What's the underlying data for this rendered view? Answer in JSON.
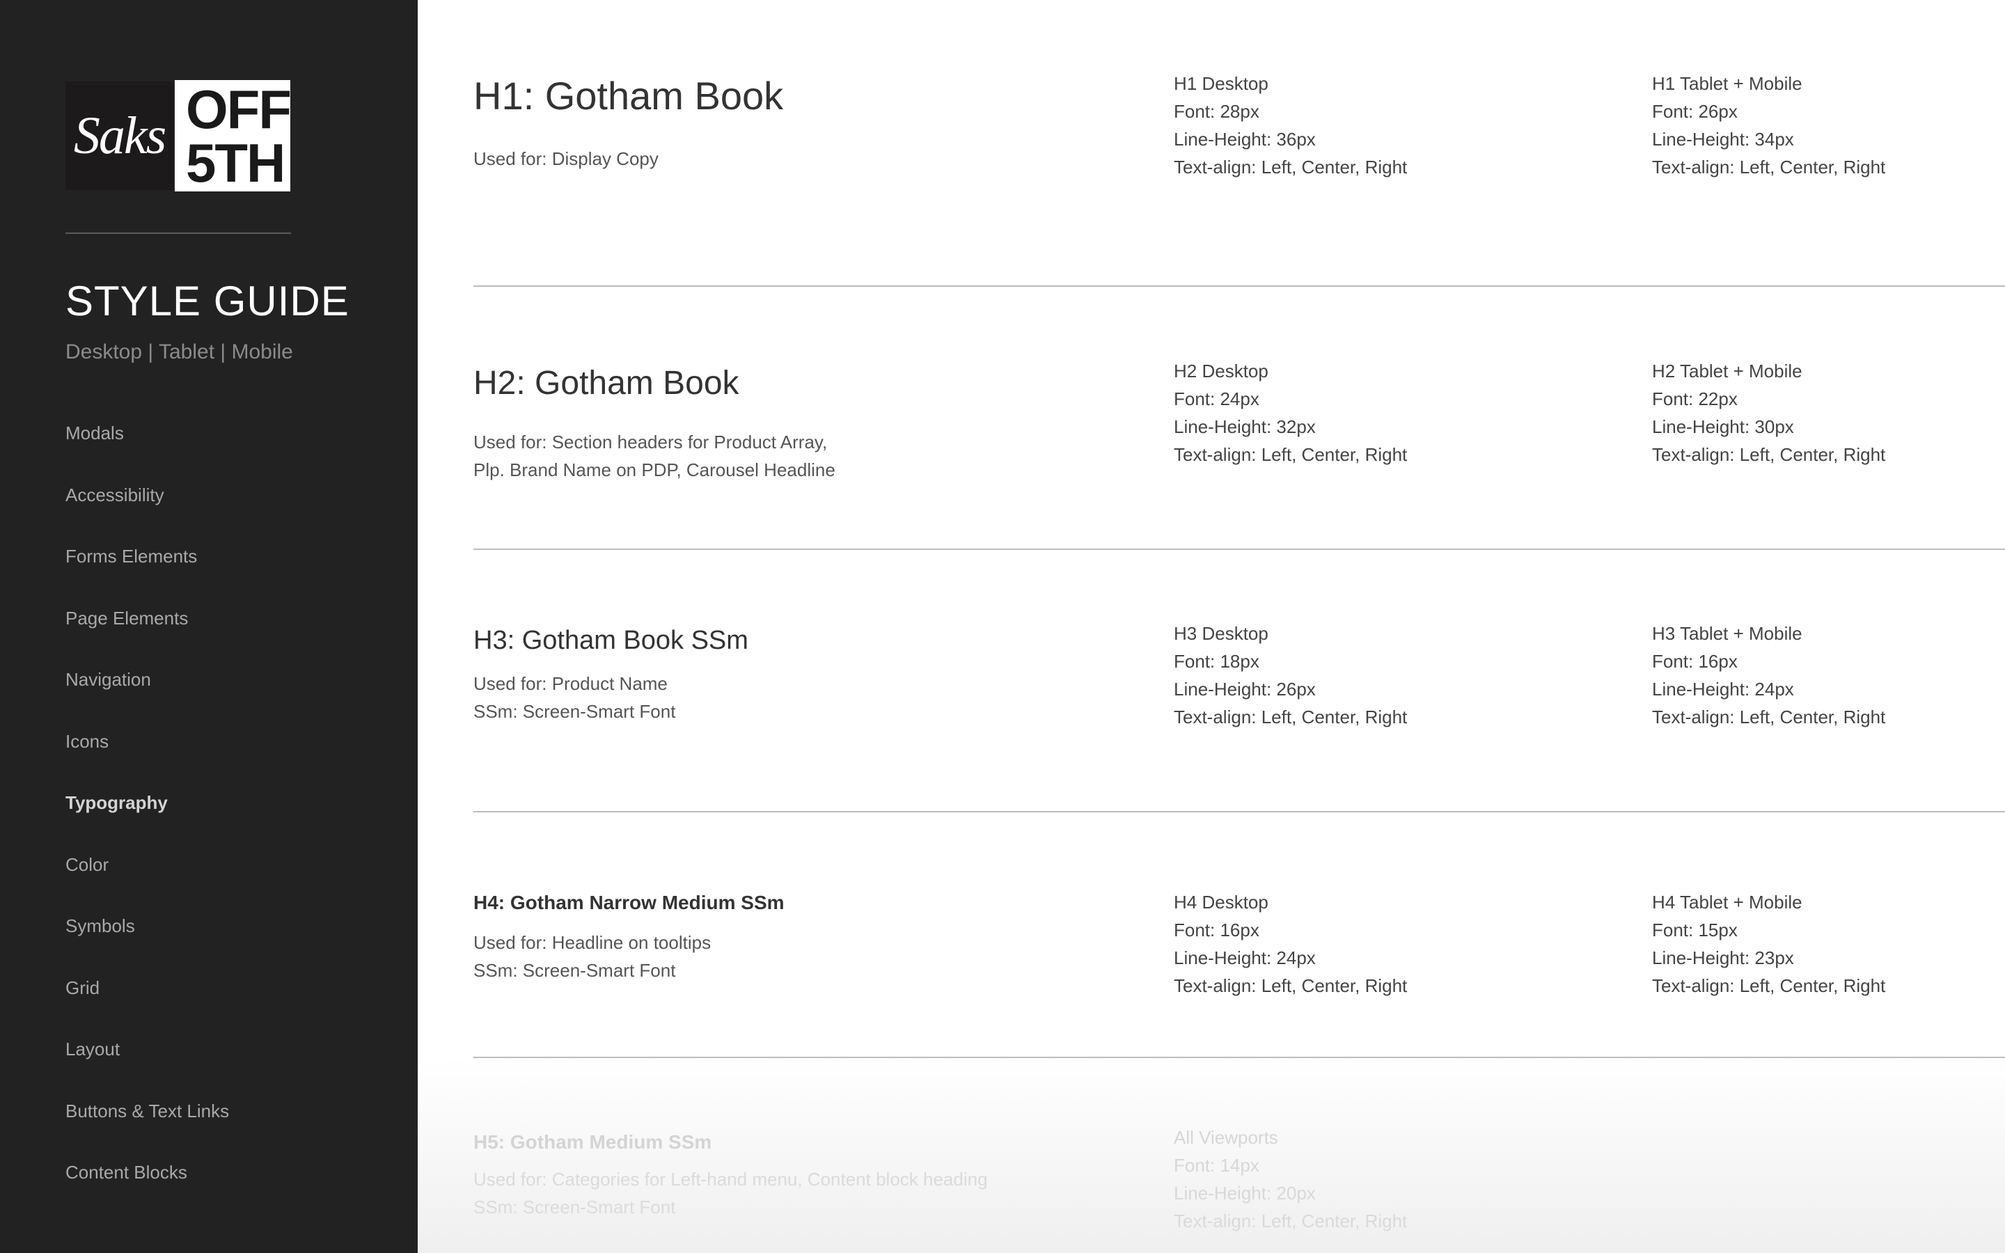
{
  "sidebar": {
    "logo_saks": "Saks",
    "logo_off": "OFF",
    "logo_5th": "5TH",
    "title": "STYLE GUIDE",
    "subtitle": "Desktop | Tablet | Mobile",
    "items": [
      {
        "label": "Modals"
      },
      {
        "label": "Accessibility"
      },
      {
        "label": "Forms Elements"
      },
      {
        "label": "Page Elements"
      },
      {
        "label": "Navigation"
      },
      {
        "label": "Icons"
      },
      {
        "label": "Typography",
        "active": true
      },
      {
        "label": "Color"
      },
      {
        "label": "Symbols"
      },
      {
        "label": "Grid"
      },
      {
        "label": "Layout"
      },
      {
        "label": "Buttons & Text Links"
      },
      {
        "label": "Content Blocks"
      }
    ]
  },
  "sections": [
    {
      "title": "H1: Gotham Book",
      "desc": [
        "Used for: Display Copy"
      ],
      "desktop": [
        "H1 Desktop",
        "Font: 28px",
        "Line-Height: 36px",
        "Text-align: Left, Center, Right"
      ],
      "mobile": [
        "H1 Tablet + Mobile",
        "Font: 26px",
        "Line-Height: 34px",
        "Text-align: Left, Center, Right"
      ]
    },
    {
      "title": "H2: Gotham Book",
      "desc": [
        "Used for: Section headers for Product Array,",
        "Plp. Brand Name on PDP, Carousel Headline"
      ],
      "desktop": [
        "H2 Desktop",
        "Font: 24px",
        "Line-Height: 32px",
        "Text-align: Left, Center, Right"
      ],
      "mobile": [
        "H2 Tablet + Mobile",
        "Font: 22px",
        "Line-Height: 30px",
        "Text-align: Left, Center, Right"
      ]
    },
    {
      "title": "H3: Gotham Book SSm",
      "desc": [
        "Used for: Product Name",
        "SSm: Screen-Smart Font"
      ],
      "desktop": [
        "H3 Desktop",
        "Font: 18px",
        "Line-Height: 26px",
        "Text-align: Left, Center, Right"
      ],
      "mobile": [
        "H3 Tablet + Mobile",
        "Font: 16px",
        "Line-Height: 24px",
        "Text-align: Left, Center, Right"
      ]
    },
    {
      "title": "H4: Gotham Narrow Medium SSm",
      "desc": [
        "Used for: Headline on tooltips",
        "SSm: Screen-Smart Font"
      ],
      "desktop": [
        "H4 Desktop",
        "Font: 16px",
        "Line-Height: 24px",
        "Text-align: Left, Center, Right"
      ],
      "mobile": [
        "H4 Tablet + Mobile",
        "Font: 15px",
        "Line-Height: 23px",
        "Text-align: Left, Center, Right"
      ]
    },
    {
      "title": "H5: Gotham Medium SSm",
      "desc": [
        "Used for: Categories for Left-hand menu, Content block heading",
        "SSm: Screen-Smart Font"
      ],
      "desktop": [
        "All Viewports",
        "Font: 14px",
        "Line-Height: 20px",
        "Text-align: Left, Center, Right"
      ]
    }
  ]
}
